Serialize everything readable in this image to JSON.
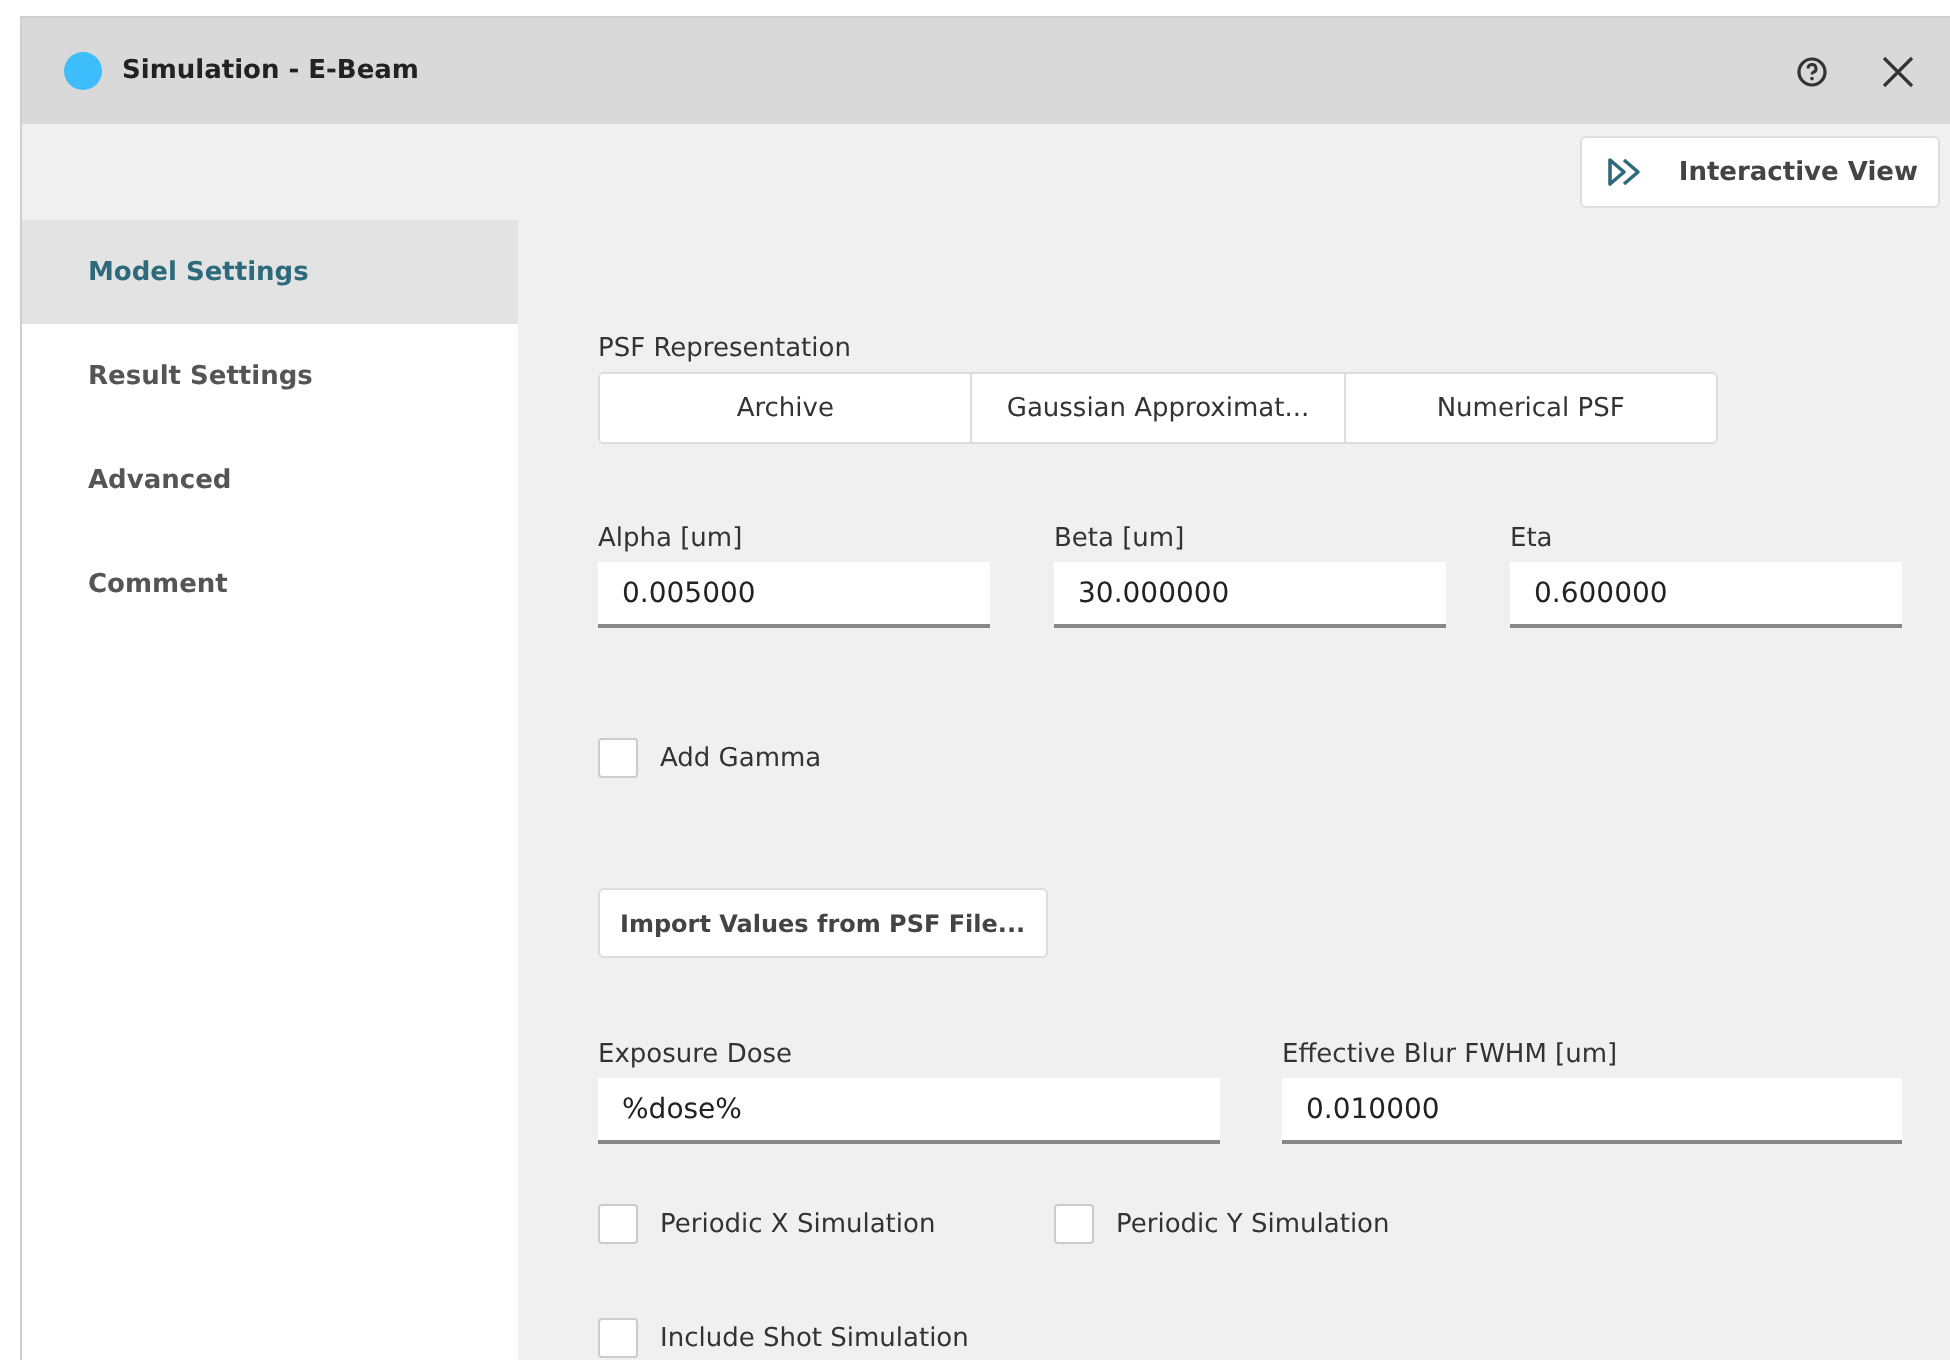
{
  "window": {
    "title": "Simulation - E-Beam"
  },
  "toolbar": {
    "interactive_view": "Interactive View"
  },
  "sidebar": {
    "items": [
      {
        "label": "Model Settings",
        "selected": true
      },
      {
        "label": "Result Settings",
        "selected": false
      },
      {
        "label": "Advanced",
        "selected": false
      },
      {
        "label": "Comment",
        "selected": false
      }
    ]
  },
  "psf": {
    "label": "PSF Representation",
    "options": [
      {
        "label": "Archive",
        "selected": false
      },
      {
        "label": "Gaussian Approximat...",
        "selected": false
      },
      {
        "label": "Numerical PSF",
        "selected": false
      }
    ]
  },
  "parameters": [
    {
      "label": "Alpha [um]",
      "value": "0.005000"
    },
    {
      "label": "Beta [um]",
      "value": "30.000000"
    },
    {
      "label": "Eta",
      "value": "0.600000"
    }
  ],
  "add_gamma": {
    "label": "Add Gamma",
    "checked": false
  },
  "import_button": "Import Values from PSF File...",
  "dose_fields": [
    {
      "label": "Exposure Dose",
      "value": "%dose%"
    },
    {
      "label": "Effective Blur FWHM [um]",
      "value": "0.010000"
    }
  ],
  "periodic": [
    {
      "label": "Periodic X Simulation",
      "checked": false
    },
    {
      "label": "Periodic Y Simulation",
      "checked": false
    }
  ],
  "shot": {
    "label": "Include Shot Simulation",
    "checked": false
  }
}
